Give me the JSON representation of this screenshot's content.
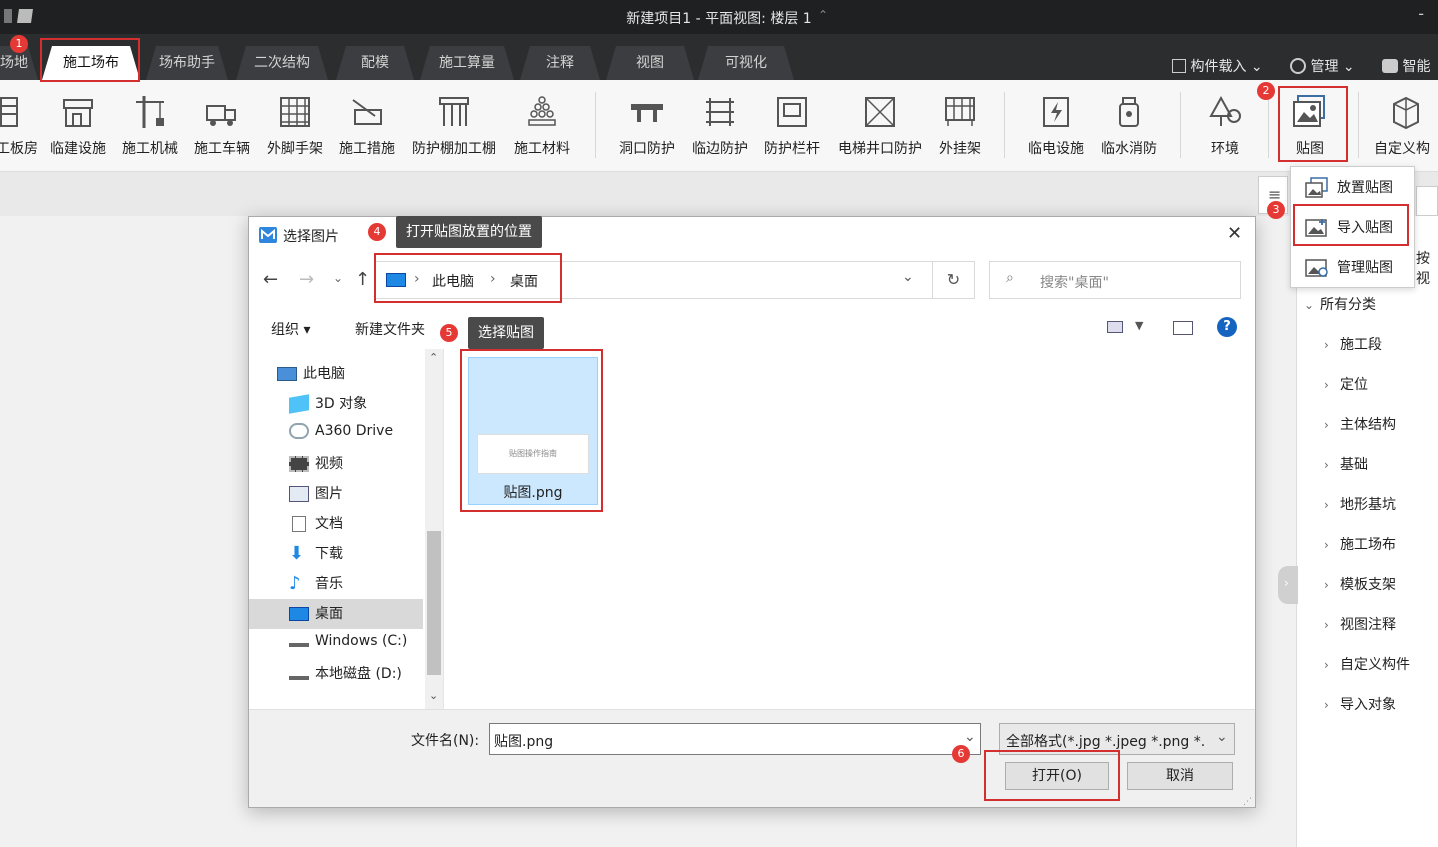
{
  "window": {
    "title": "新建项目1 - 平面视图: 楼层 1",
    "min": "-"
  },
  "tabs": [
    {
      "label": "场地"
    },
    {
      "label": "施工场布"
    },
    {
      "label": "场布助手"
    },
    {
      "label": "二次结构"
    },
    {
      "label": "配模"
    },
    {
      "label": "施工算量"
    },
    {
      "label": "注释"
    },
    {
      "label": "视图"
    },
    {
      "label": "可视化"
    }
  ],
  "right_tools": {
    "load": "构件载入",
    "manage": "管理",
    "smart": "智能"
  },
  "ribbon": [
    "工板房",
    "临建设施",
    "施工机械",
    "施工车辆",
    "外脚手架",
    "施工措施",
    "防护棚加工棚",
    "施工材料",
    "洞口防护",
    "临边防护",
    "防护栏杆",
    "电梯井口防护",
    "外挂架",
    "临电设施",
    "临水消防",
    "环境",
    "贴图",
    "自定义构"
  ],
  "dropdown": {
    "place": "放置贴图",
    "import": "导入贴图",
    "manage": "管理贴图"
  },
  "panel_tree": {
    "partial": "按视",
    "root": "所有分类",
    "items": [
      "施工段",
      "定位",
      "主体结构",
      "基础",
      "地形基坑",
      "施工场布",
      "模板支架",
      "视图注释",
      "自定义构件",
      "导入对象"
    ]
  },
  "dialog": {
    "title": "选择图片",
    "close": "✕",
    "breadcrumb": {
      "root": "此电脑",
      "current": "桌面"
    },
    "search_placeholder": "搜索\"桌面\"",
    "toolbar": {
      "organize": "组织 ▾",
      "new_folder": "新建文件夹"
    },
    "nav": [
      "此电脑",
      "3D 对象",
      "A360 Drive",
      "视频",
      "图片",
      "文档",
      "下载",
      "音乐",
      "桌面",
      "Windows (C:)",
      "本地磁盘 (D:)"
    ],
    "file": {
      "name": "贴图.png",
      "thumb_text": "贴图操作指南"
    },
    "filename_label": "文件名(N):",
    "filename_value": "贴图.png",
    "filter": "全部格式(*.jpg *.jpeg *.png *.",
    "open": "打开(O)",
    "cancel": "取消"
  },
  "callouts": {
    "c4": "打开贴图放置的位置",
    "c5": "选择贴图"
  },
  "badges": [
    "1",
    "2",
    "3",
    "4",
    "5",
    "6"
  ]
}
